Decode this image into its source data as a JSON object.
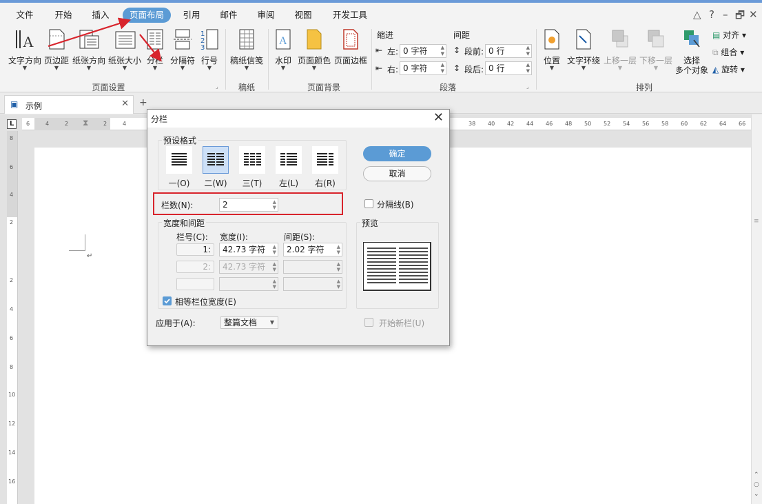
{
  "menu": {
    "tabs": [
      "文件",
      "开始",
      "插入",
      "页面布局",
      "引用",
      "邮件",
      "审阅",
      "视图",
      "开发工具"
    ],
    "active": "页面布局"
  },
  "ribbon": {
    "page_setup": {
      "buttons": [
        "文字方向",
        "页边距",
        "纸张方向",
        "纸张大小",
        "分栏",
        "分隔符",
        "行号"
      ],
      "group_label": "页面设置"
    },
    "manuscript": {
      "button": "稿纸信笺",
      "group_label": "稿纸"
    },
    "background": {
      "buttons": [
        "水印",
        "页面颜色",
        "页面边框"
      ],
      "group_label": "页面背景"
    },
    "paragraph": {
      "indent_title": "缩进",
      "spacing_title": "间距",
      "left_label": "左:",
      "left_value": "0 字符",
      "right_label": "右:",
      "right_value": "0 字符",
      "before_label": "段前:",
      "before_value": "0 行",
      "after_label": "段后:",
      "after_value": "0 行",
      "group_label": "段落"
    },
    "arrange": {
      "buttons": [
        "位置",
        "文字环绕",
        "上移一层",
        "下移一层"
      ],
      "select_line1": "选择",
      "select_line2": "多个对象",
      "align": "对齐",
      "group": "组合",
      "rotate": "旋转",
      "group_label": "排列"
    }
  },
  "doc_tab": {
    "title": "示例",
    "add": "+"
  },
  "ruler": {
    "top_left": [
      "6",
      "4",
      "2"
    ],
    "top": [
      "2",
      "4",
      "38",
      "40",
      "42",
      "44",
      "46",
      "48",
      "50",
      "52",
      "54",
      "56",
      "58",
      "60",
      "62",
      "64",
      "66",
      "68"
    ],
    "side": [
      "8",
      "6",
      "4",
      "2",
      "2",
      "4",
      "6",
      "8",
      "10",
      "12",
      "14",
      "16",
      "18"
    ]
  },
  "dialog": {
    "title": "分栏",
    "preset_title": "预设格式",
    "presets": [
      "一(O)",
      "二(W)",
      "三(T)",
      "左(L)",
      "右(R)"
    ],
    "selected_preset": "二(W)",
    "ok": "确定",
    "cancel": "取消",
    "cols_label": "栏数(N):",
    "cols_value": "2",
    "divider_label": "分隔线(B)",
    "width_title": "宽度和间距",
    "col_no_label": "栏号(C):",
    "width_label": "宽度(I):",
    "spacing_label": "间距(S):",
    "rows": [
      {
        "no": "1:",
        "width": "42.73 字符",
        "spacing": "2.02 字符"
      },
      {
        "no": "2:",
        "width": "42.73 字符",
        "spacing": ""
      },
      {
        "no": "",
        "width": "",
        "spacing": ""
      }
    ],
    "equal_label": "相等栏位宽度(E)",
    "equal_checked": true,
    "apply_label": "应用于(A):",
    "apply_value": "整篇文档",
    "preview_title": "预览",
    "new_col_label": "开始新栏(U)"
  },
  "colors": {
    "accent": "#5b9bd5",
    "highlight": "#d8242c"
  }
}
